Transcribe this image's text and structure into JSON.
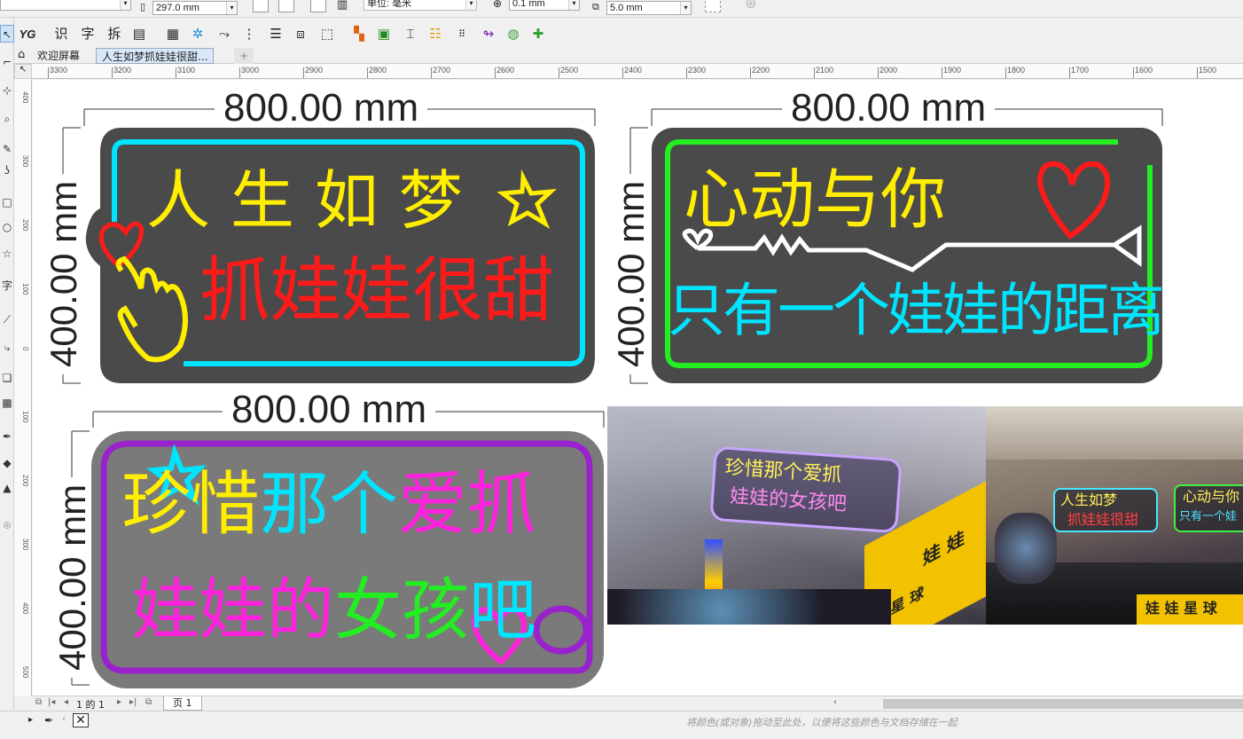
{
  "property_bar": {
    "width_value": "297.0 mm",
    "units_label": "单位: 毫米",
    "outline_width": "0.1 mm",
    "nudge_value": "5.0 mm"
  },
  "toolbar": {
    "yg_label": "YG",
    "shi_label": "识",
    "zi_label": "字",
    "chai_label": "拆"
  },
  "tabs": {
    "welcome": "欢迎屏幕",
    "document": "人生如梦抓娃娃很甜..."
  },
  "hruler_ticks": [
    "3300",
    "3200",
    "3100",
    "3000",
    "2900",
    "2800",
    "2700",
    "2600",
    "2500",
    "2400",
    "2300",
    "2200",
    "2100",
    "2000",
    "1900",
    "1800",
    "1700",
    "1600",
    "1500"
  ],
  "vruler_ticks": [
    "400",
    "300",
    "200",
    "100",
    "0",
    "100",
    "200",
    "300",
    "400",
    "500"
  ],
  "designs": {
    "sign1": {
      "width_dim": "800.00 mm",
      "height_dim": "400.00 mm",
      "line1": [
        "人",
        "生",
        "如",
        "梦"
      ],
      "line2": "抓娃娃很甜"
    },
    "sign2": {
      "width_dim": "800.00 mm",
      "height_dim": "400.00 mm",
      "line1": "心动与你",
      "line2": "只有一个娃娃的距离"
    },
    "sign3": {
      "width_dim": "800.00 mm",
      "height_dim": "400.00 mm",
      "line1_a": "珍惜",
      "line1_b": "那个",
      "line1_c": "爱抓",
      "line2_a": "娃娃的",
      "line2_b": "女孩",
      "line2_c": "吧"
    }
  },
  "photos": {
    "photo1_line1": "珍惜那个爱抓",
    "photo1_line2": "娃娃的女孩吧",
    "photo1_wall": "娃 娃",
    "photo1_wall2": "娃 星 球",
    "photo2_sign_a1": "人生如梦",
    "photo2_sign_a2": "抓娃娃很甜",
    "photo2_sign_b1": "心动与你",
    "photo2_sign_b2": "只有一个娃",
    "photo2_wall": "娃 娃 星 球"
  },
  "page_nav": {
    "page_of": "1 的 1",
    "page_tab": "页 1"
  },
  "status": {
    "hint": "将颜色(或对象)拖动至此处，以便将这些颜色与文档存储在一起"
  },
  "colors": {
    "board_dark": "#4a4a4a",
    "board_gray": "#7a7a7a",
    "neon_cyan": "#00e5ff",
    "neon_yellow": "#ffee00",
    "neon_red": "#ff1a1a",
    "neon_green": "#22ee22",
    "neon_magenta": "#ff22dd",
    "neon_purple": "#9922cc"
  }
}
